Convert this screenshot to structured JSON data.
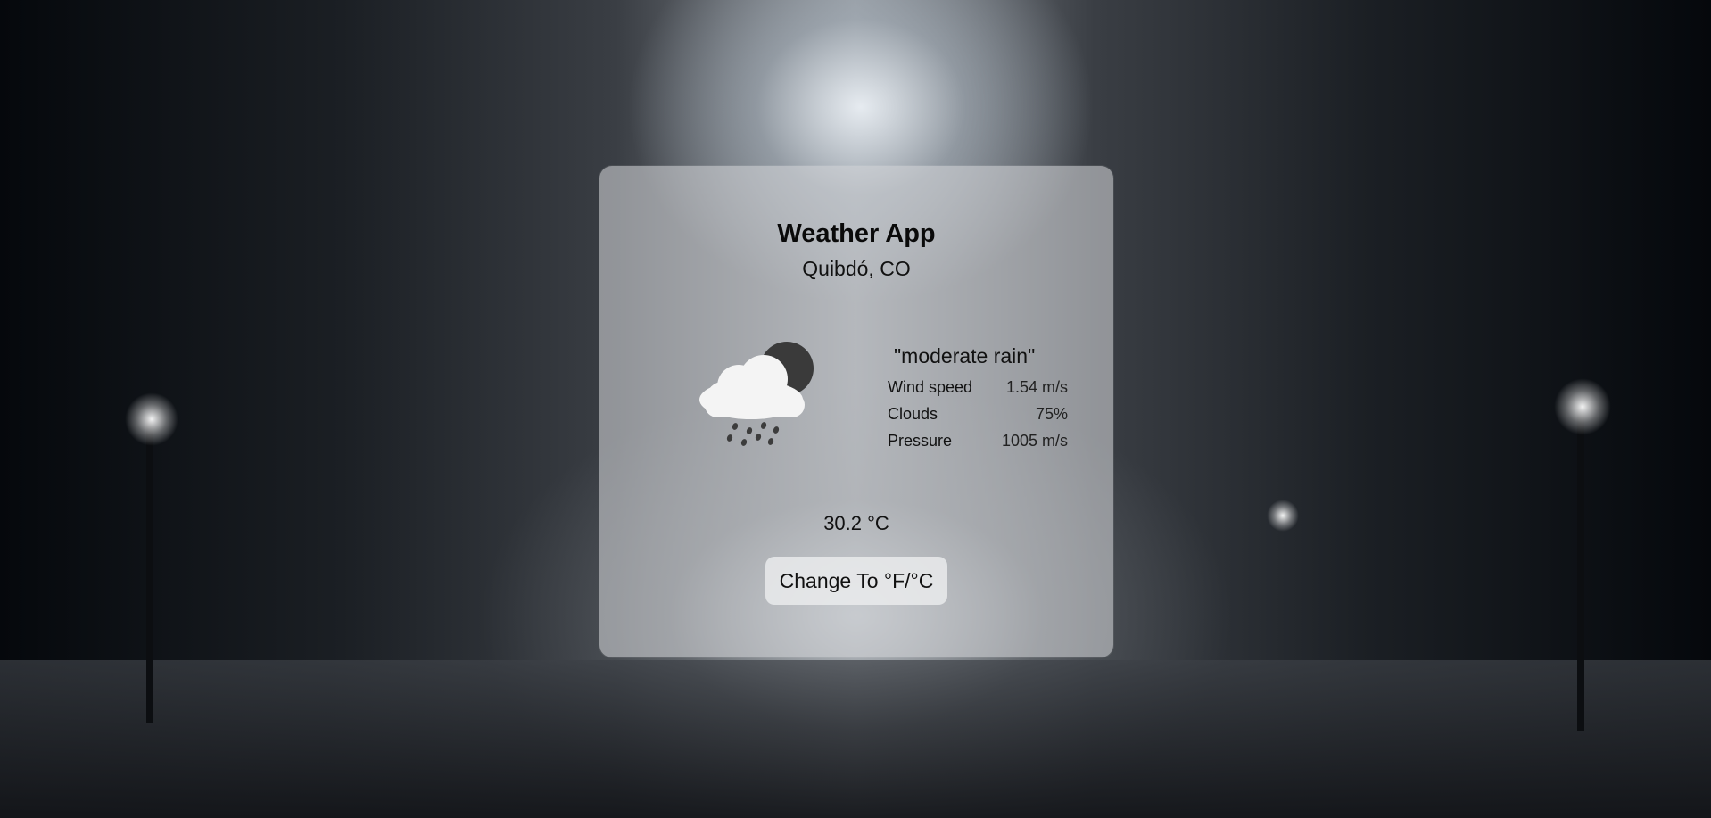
{
  "app": {
    "title": "Weather App",
    "location": "Quibdó, CO"
  },
  "weather": {
    "icon": "cloud-sun-rain-icon",
    "description": "\"moderate rain\"",
    "stats": [
      {
        "label": "Wind speed",
        "value": "1.54 m/s"
      },
      {
        "label": "Clouds",
        "value": "75%"
      },
      {
        "label": "Pressure",
        "value": "1005 m/s"
      }
    ],
    "temperature": "30.2 °C"
  },
  "controls": {
    "toggle_units_label": "Change To °F/°C"
  },
  "colors": {
    "card_background": "#d2d4d7",
    "text": "#111111",
    "button_background": "#ecedee"
  }
}
